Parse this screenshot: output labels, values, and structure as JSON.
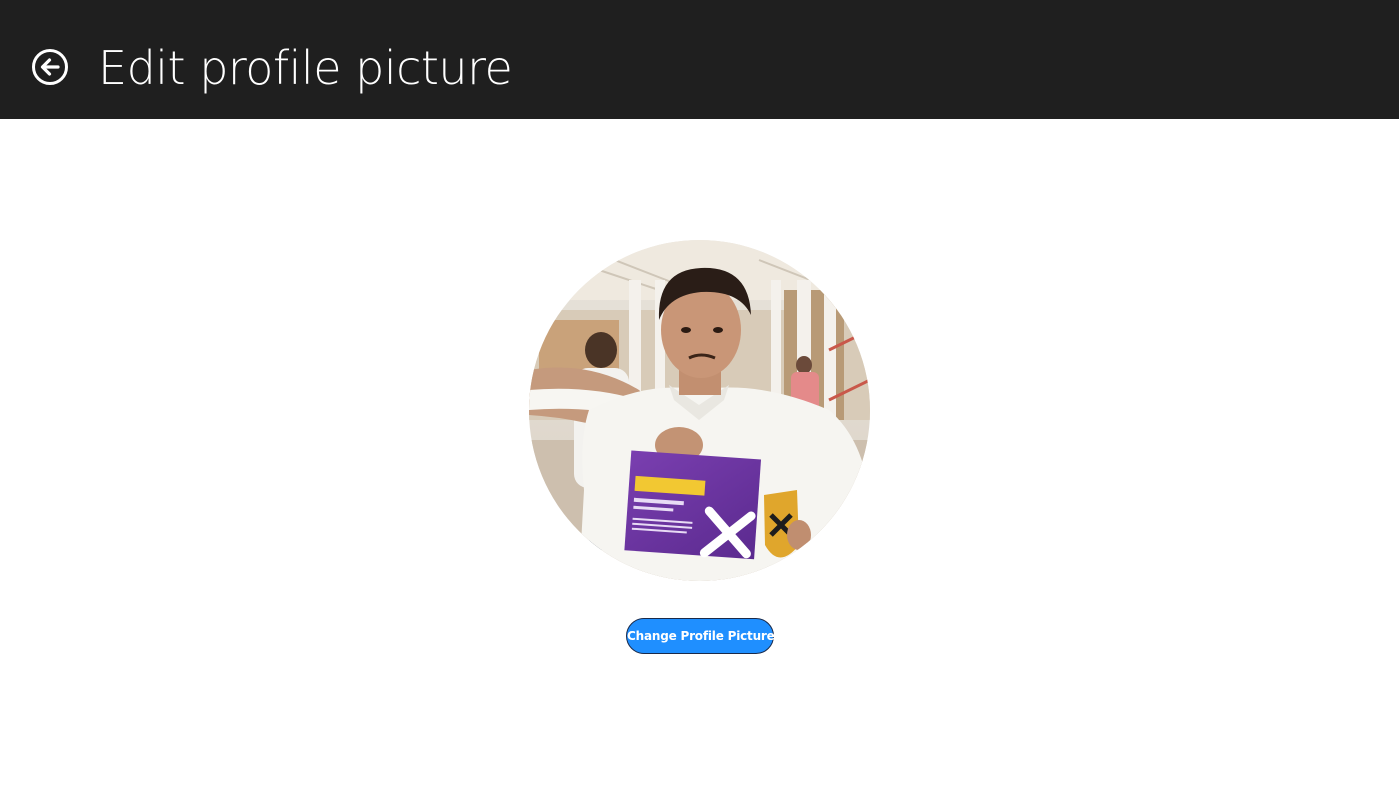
{
  "header": {
    "title": "Edit profile picture",
    "back_icon": "back-arrow-circle-icon",
    "background": "#1f1f1f"
  },
  "profile": {
    "picture_description": "profile-photo"
  },
  "actions": {
    "change_picture_label": "Change Profile Picture",
    "accent": "#1f8fff"
  }
}
